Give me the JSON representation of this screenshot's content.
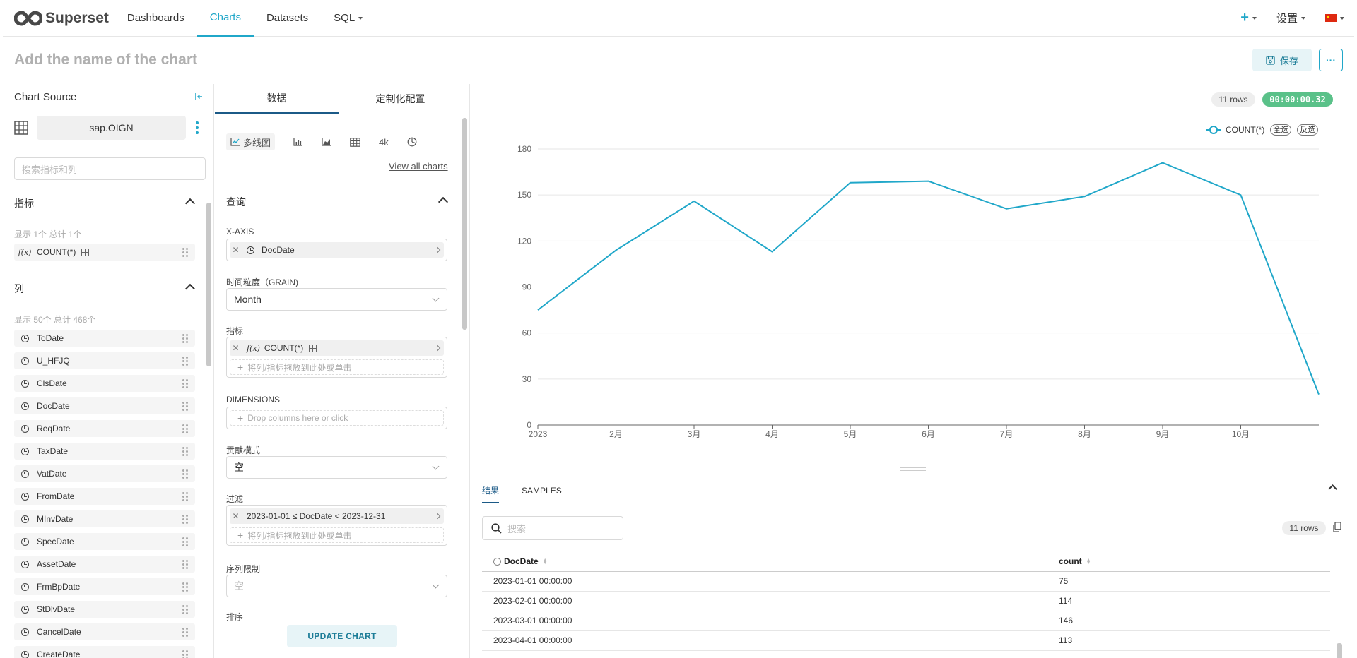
{
  "nav": {
    "brand": "Superset",
    "items": [
      "Dashboards",
      "Charts",
      "Datasets",
      "SQL"
    ],
    "active": "Charts",
    "settings_label": "设置"
  },
  "title_bar": {
    "chart_name_placeholder": "Add the name of the chart",
    "save_label": "保存",
    "more_label": "···"
  },
  "datasource": {
    "title": "Chart Source",
    "name": "sap.OIGN",
    "search_placeholder": "搜索指标和列",
    "metrics_header": "指标",
    "metrics_count": "显示 1个 总计 1个",
    "metrics": [
      "COUNT(*)"
    ],
    "columns_header": "列",
    "columns_count": "显示 50个 总计 468个",
    "columns": [
      "ToDate",
      "U_HFJQ",
      "ClsDate",
      "DocDate",
      "ReqDate",
      "TaxDate",
      "VatDate",
      "FromDate",
      "MInvDate",
      "SpecDate",
      "AssetDate",
      "FrmBpDate",
      "StDlvDate",
      "CancelDate",
      "CreateDate"
    ]
  },
  "controls": {
    "tab_data": "数据",
    "tab_custom": "定制化配置",
    "viz_active_label": "多线图",
    "viz_4k": "4k",
    "view_all": "View all charts",
    "query_header": "查询",
    "x_axis_label": "X-AXIS",
    "x_axis_value": "DocDate",
    "grain_label": "时间粒度（GRAIN)",
    "grain_value": "Month",
    "metrics_label": "指标",
    "metrics_value": "COUNT(*)",
    "drop_placeholder_cn": "将列/指标拖放到此处或单击",
    "dimensions_label": "DIMENSIONS",
    "dimensions_placeholder": "Drop columns here or click",
    "contribution_label": "贡献模式",
    "contribution_value": "空",
    "filters_label": "过滤",
    "filter_value": "2023-01-01 ≤ DocDate < 2023-12-31",
    "series_limit_label": "序列限制",
    "series_limit_value": "空",
    "sort_label": "排序",
    "update_label": "UPDATE CHART"
  },
  "chart_meta": {
    "rows_badge": "11 rows",
    "time_badge": "00:00:00.32",
    "legend_select_all": "全选",
    "legend_invert": "反选"
  },
  "chart_data": {
    "type": "line",
    "x": [
      "2023-01",
      "2023-02",
      "2023-03",
      "2023-04",
      "2023-05",
      "2023-06",
      "2023-07",
      "2023-08",
      "2023-09",
      "2023-10",
      "2023-11"
    ],
    "x_tick_labels": [
      "2023",
      "2月",
      "3月",
      "4月",
      "5月",
      "6月",
      "7月",
      "8月",
      "9月",
      "10月"
    ],
    "series": [
      {
        "name": "COUNT(*)",
        "values": [
          75,
          114,
          146,
          113,
          158,
          159,
          141,
          149,
          171,
          150,
          20
        ]
      }
    ],
    "yticks": [
      0,
      30,
      60,
      90,
      120,
      150,
      180
    ],
    "ylim": [
      0,
      180
    ],
    "grid": true,
    "legend_position": "top-right",
    "color": "#20a7c9"
  },
  "data_pane": {
    "tab_results": "结果",
    "tab_samples": "SAMPLES",
    "search_placeholder": "搜索",
    "rows_badge": "11 rows",
    "columns": [
      "DocDate",
      "count"
    ],
    "rows": [
      [
        "2023-01-01 00:00:00",
        "75"
      ],
      [
        "2023-02-01 00:00:00",
        "114"
      ],
      [
        "2023-03-01 00:00:00",
        "146"
      ],
      [
        "2023-04-01 00:00:00",
        "113"
      ]
    ]
  }
}
